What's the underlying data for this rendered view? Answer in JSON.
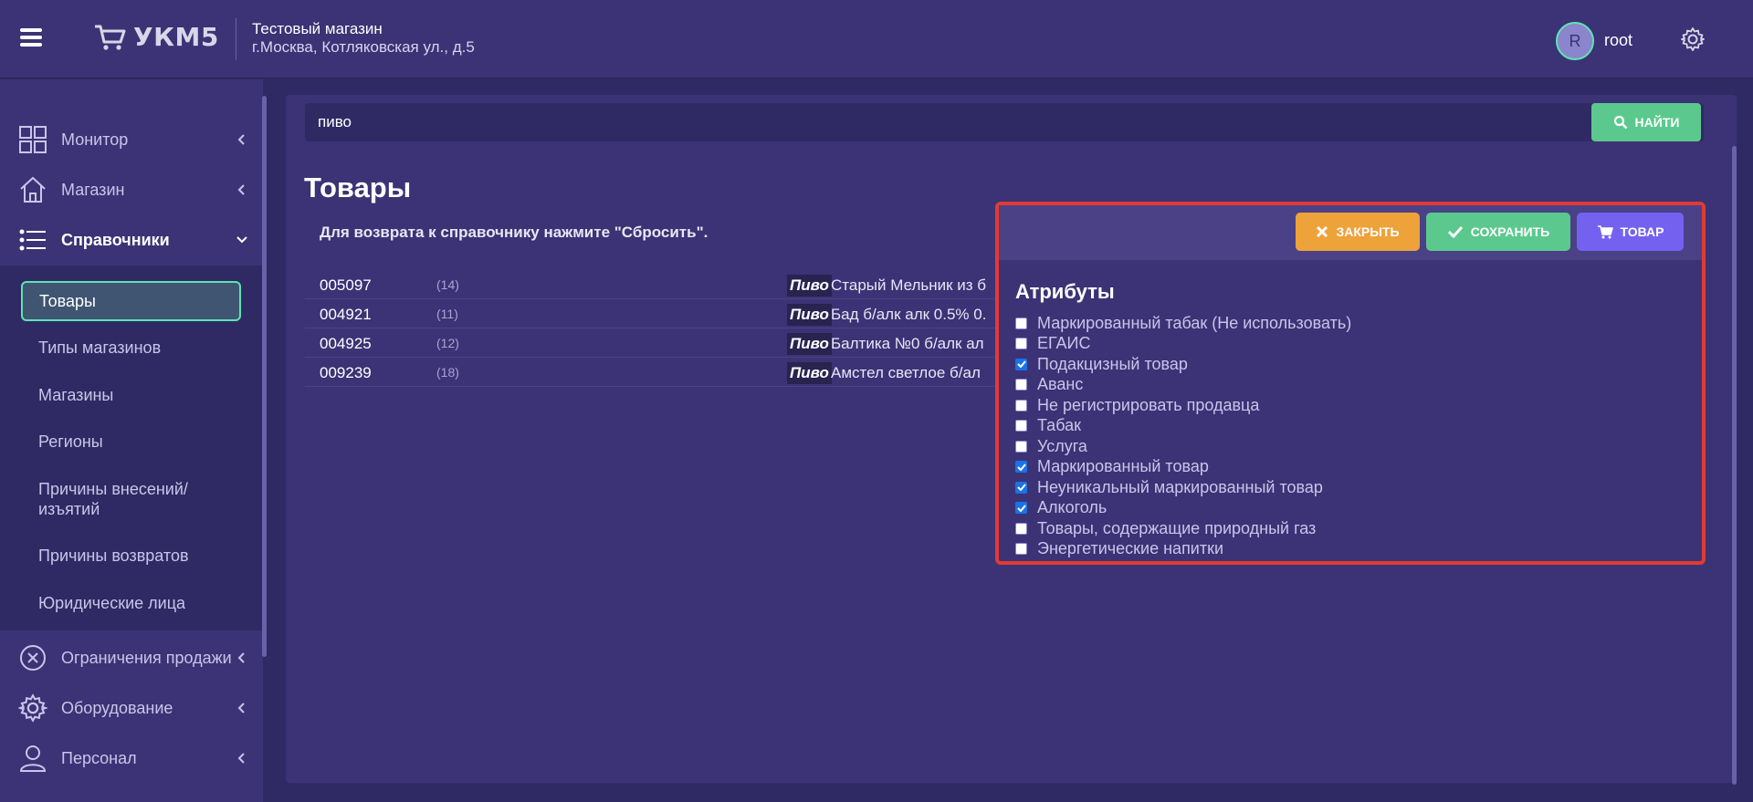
{
  "header": {
    "logo_text": "УКМ5",
    "store_name": "Тестовый магазин",
    "store_address": "г.Москва, Котляковская ул., д.5",
    "avatar_letter": "R",
    "user_name": "root"
  },
  "sidebar": {
    "items": [
      {
        "label": "Монитор",
        "icon": "monitor-grid-icon"
      },
      {
        "label": "Магазин",
        "icon": "home-icon"
      },
      {
        "label": "Справочники",
        "icon": "list-icon"
      }
    ],
    "submenu": [
      {
        "label": "Товары"
      },
      {
        "label": "Типы магазинов"
      },
      {
        "label": "Магазины"
      },
      {
        "label": "Регионы"
      },
      {
        "label": "Причины внесений/ изъятий"
      },
      {
        "label": "Причины возвратов"
      },
      {
        "label": "Юридические лица"
      }
    ],
    "items_bottom": [
      {
        "label": "Ограничения продажи",
        "icon": "cancel-circle-icon"
      },
      {
        "label": "Оборудование",
        "icon": "gear-icon"
      },
      {
        "label": "Персонал",
        "icon": "person-icon"
      }
    ]
  },
  "search": {
    "value": "пиво",
    "button_label": "НАЙТИ"
  },
  "main": {
    "title": "Товары",
    "hint": "Для возврата к справочнику нажмите \"Сбросить\".",
    "rows": [
      {
        "code": "005097",
        "count": "(14)",
        "group": "Пиво",
        "name": "Старый Мельник из б"
      },
      {
        "code": "004921",
        "count": "(11)",
        "group": "Пиво",
        "name": "Бад б/алк алк 0.5% 0."
      },
      {
        "code": "004925",
        "count": "(12)",
        "group": "Пиво",
        "name": "Балтика №0 б/алк ал"
      },
      {
        "code": "009239",
        "count": "(18)",
        "group": "Пиво",
        "name": "Амстел светлое б/ал"
      }
    ]
  },
  "panel": {
    "close_label": "ЗАКРЫТЬ",
    "save_label": "СОХРАНИТЬ",
    "item_label": "ТОВАР",
    "attributes_title": "Атрибуты",
    "attributes": [
      {
        "label": "Маркированный табак (Не использовать)",
        "checked": false
      },
      {
        "label": "ЕГАИС",
        "checked": false
      },
      {
        "label": "Подакцизный товар",
        "checked": true
      },
      {
        "label": "Аванс",
        "checked": false
      },
      {
        "label": "Не регистрировать продавца",
        "checked": false
      },
      {
        "label": "Табак",
        "checked": false
      },
      {
        "label": "Услуга",
        "checked": false
      },
      {
        "label": "Маркированный товар",
        "checked": true
      },
      {
        "label": "Неуникальный маркированный товар",
        "checked": true
      },
      {
        "label": "Алкоголь",
        "checked": true
      },
      {
        "label": "Товары, содержащие природный газ",
        "checked": false
      },
      {
        "label": "Энергетические напитки",
        "checked": false
      }
    ]
  },
  "colors": {
    "accent_green": "#5bc98e",
    "accent_orange": "#eea23a",
    "accent_purple": "#7561f0",
    "highlight_red": "#e13a32"
  }
}
